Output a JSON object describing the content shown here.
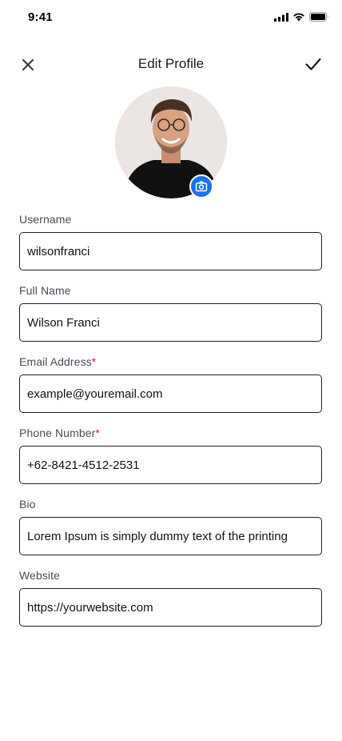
{
  "status_bar": {
    "time": "9:41",
    "icons": [
      "signal-bars-icon",
      "wifi-icon",
      "battery-icon"
    ]
  },
  "header": {
    "title": "Edit Profile",
    "left_icon": "close-icon",
    "right_icon": "check-icon"
  },
  "profile": {
    "camera_icon": "camera-icon",
    "accent": "#1a73e8"
  },
  "fields": {
    "username": {
      "label": "Username",
      "required": "",
      "value": "wilsonfranci"
    },
    "full_name": {
      "label": "Full Name",
      "required": "",
      "value": "Wilson Franci"
    },
    "email": {
      "label": "Email Address",
      "required": "*",
      "value": "example@youremail.com"
    },
    "phone": {
      "label": "Phone Number",
      "required": "*",
      "value": "+62-8421-4512-2531"
    },
    "bio": {
      "label": "Bio",
      "required": "",
      "value": "Lorem Ipsum is simply dummy text of the printing"
    },
    "website": {
      "label": "Website",
      "required": "",
      "value": "https://yourwebsite.com"
    }
  },
  "colors": {
    "required_marker": "#c2185b",
    "icon_dark": "#3a3a4a"
  }
}
